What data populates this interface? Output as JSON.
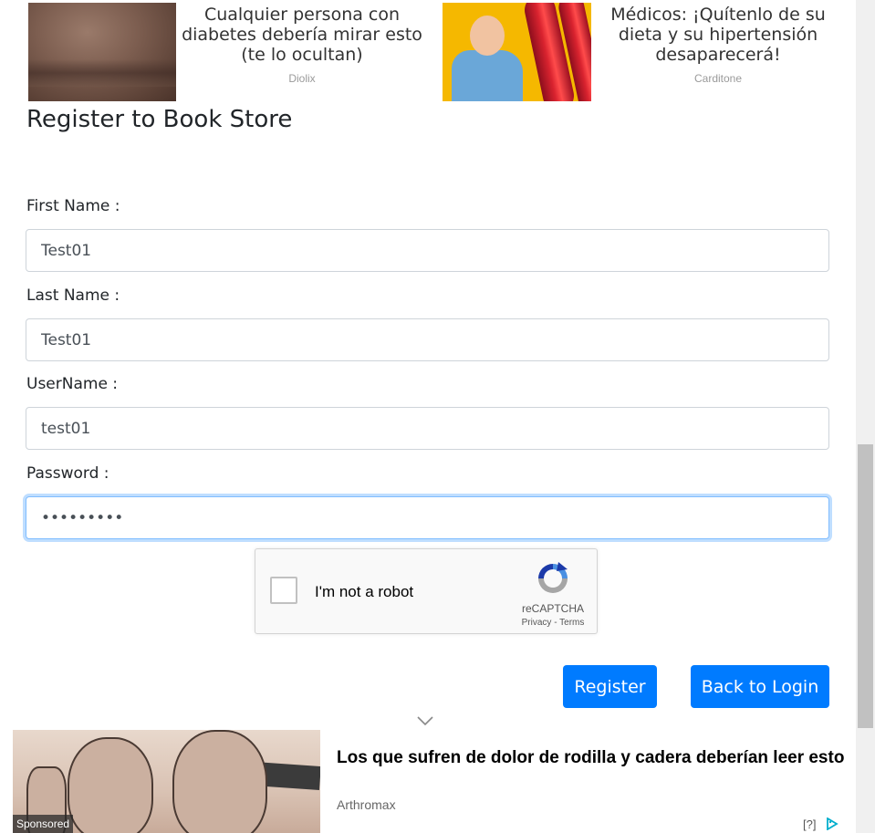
{
  "top_ads": [
    {
      "title": "Cualquier persona con diabetes debería mirar esto (te lo ocultan)",
      "brand": "Diolix"
    },
    {
      "title": "Médicos: ¡Quítenlo de su dieta y su hipertensión desaparecerá!",
      "brand": "Carditone"
    }
  ],
  "form": {
    "title": "Register to Book Store",
    "first_name": {
      "label": "First Name :",
      "value": "Test01"
    },
    "last_name": {
      "label": "Last Name :",
      "value": "Test01"
    },
    "username": {
      "label": "UserName :",
      "value": "test01"
    },
    "password": {
      "label": "Password :",
      "value": "•••••••••"
    }
  },
  "captcha": {
    "label": "I'm not a robot",
    "brand": "reCAPTCHA",
    "links": "Privacy - Terms"
  },
  "buttons": {
    "register": "Register",
    "back": "Back to Login"
  },
  "bottom_ad": {
    "title": "Los que sufren de dolor de rodilla y cadera deberían leer esto",
    "brand": "Arthromax",
    "sponsored": "Sponsored",
    "adchoices": "[?]"
  },
  "colors": {
    "primary": "#007bff",
    "focus": "#80bdff"
  }
}
